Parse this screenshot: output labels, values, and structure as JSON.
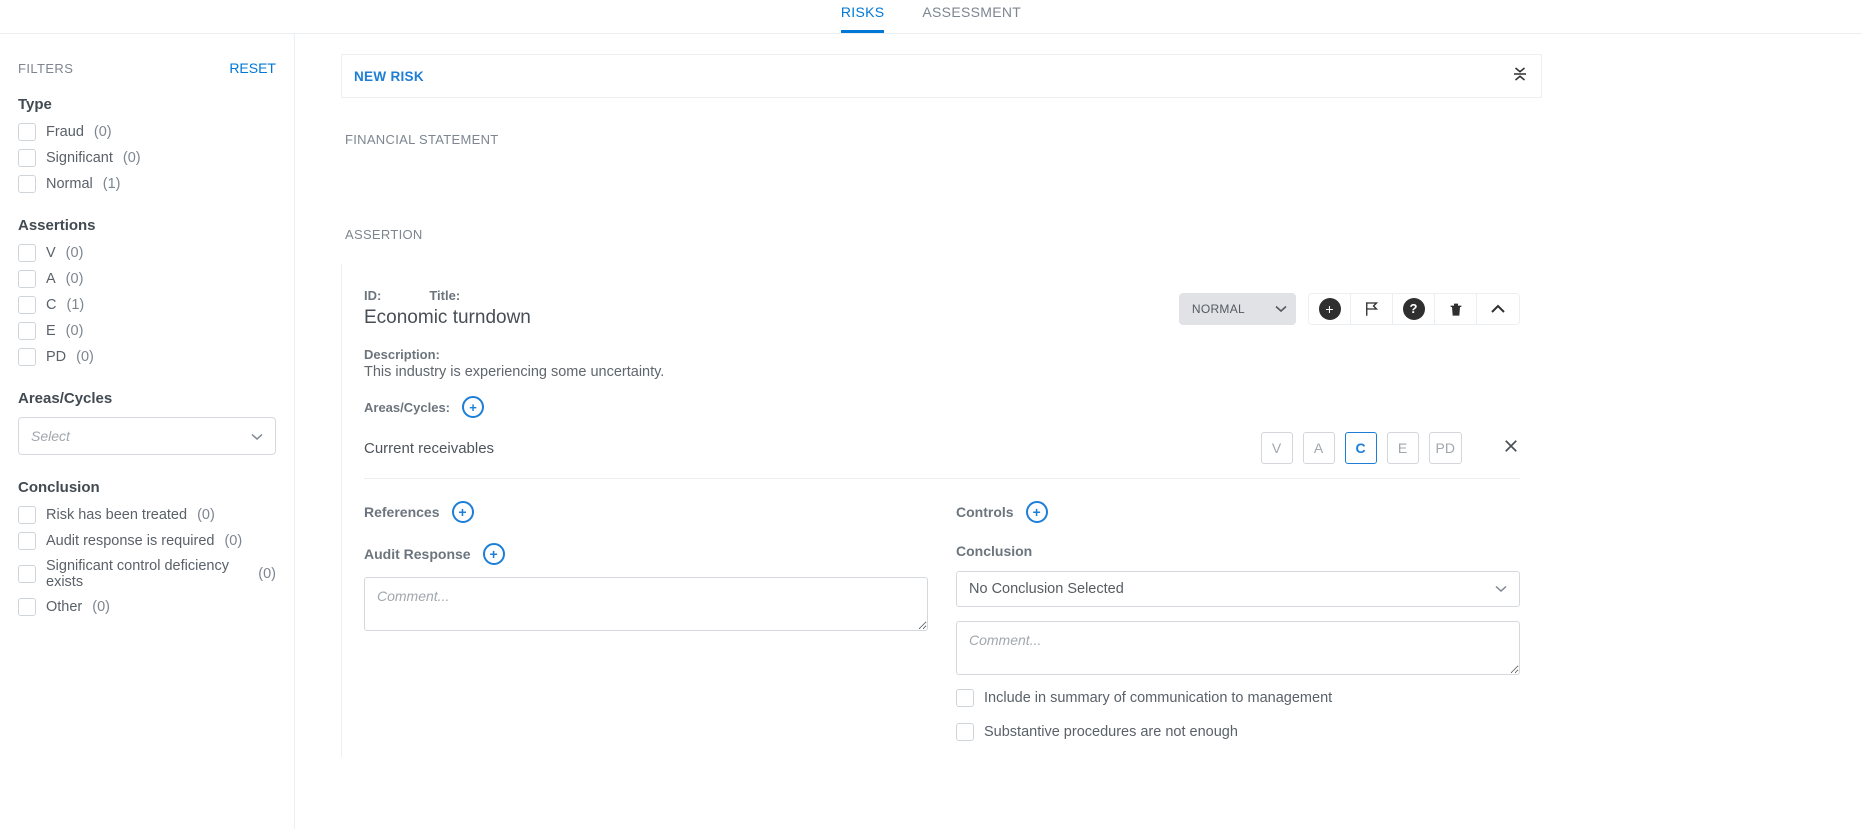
{
  "tabs": {
    "risks": "RISKS",
    "assessment": "ASSESSMENT",
    "active": "risks"
  },
  "filters": {
    "title": "FILTERS",
    "reset": "RESET",
    "type": {
      "title": "Type",
      "items": [
        {
          "label": "Fraud",
          "count": "(0)"
        },
        {
          "label": "Significant",
          "count": "(0)"
        },
        {
          "label": "Normal",
          "count": "(1)"
        }
      ]
    },
    "assertions": {
      "title": "Assertions",
      "items": [
        {
          "label": "V",
          "count": "(0)"
        },
        {
          "label": "A",
          "count": "(0)"
        },
        {
          "label": "C",
          "count": "(1)"
        },
        {
          "label": "E",
          "count": "(0)"
        },
        {
          "label": "PD",
          "count": "(0)"
        }
      ]
    },
    "areas": {
      "title": "Areas/Cycles",
      "placeholder": "Select"
    },
    "conclusion": {
      "title": "Conclusion",
      "items": [
        {
          "label": "Risk has been treated",
          "count": "(0)"
        },
        {
          "label": "Audit response is required",
          "count": "(0)"
        },
        {
          "label": "Significant control deficiency exists",
          "count": "(0)"
        },
        {
          "label": "Other",
          "count": "(0)"
        }
      ]
    }
  },
  "main": {
    "newRisk": "NEW RISK",
    "sectionFinancial": "FINANCIAL STATEMENT",
    "sectionAssertion": "ASSERTION"
  },
  "risk": {
    "idLabel": "ID:",
    "titleLabel": "Title:",
    "title": "Economic turndown",
    "typeValue": "NORMAL",
    "descriptionLabel": "Description:",
    "description": "This industry is experiencing some uncertainty.",
    "areasLabel": "Areas/Cycles:",
    "cycles": [
      {
        "name": "Current receivables",
        "assertions": [
          "V",
          "A",
          "C",
          "E",
          "PD"
        ],
        "active": "C"
      }
    ],
    "referencesLabel": "References",
    "auditResponseLabel": "Audit Response",
    "commentPlaceholder": "Comment...",
    "controlsLabel": "Controls",
    "conclusionLabel": "Conclusion",
    "conclusionValue": "No Conclusion Selected",
    "conclusionCommentPlaceholder": "Comment...",
    "includeSummaryLabel": "Include in summary of communication to management",
    "substantiveLabel": "Substantive procedures are not enough"
  }
}
